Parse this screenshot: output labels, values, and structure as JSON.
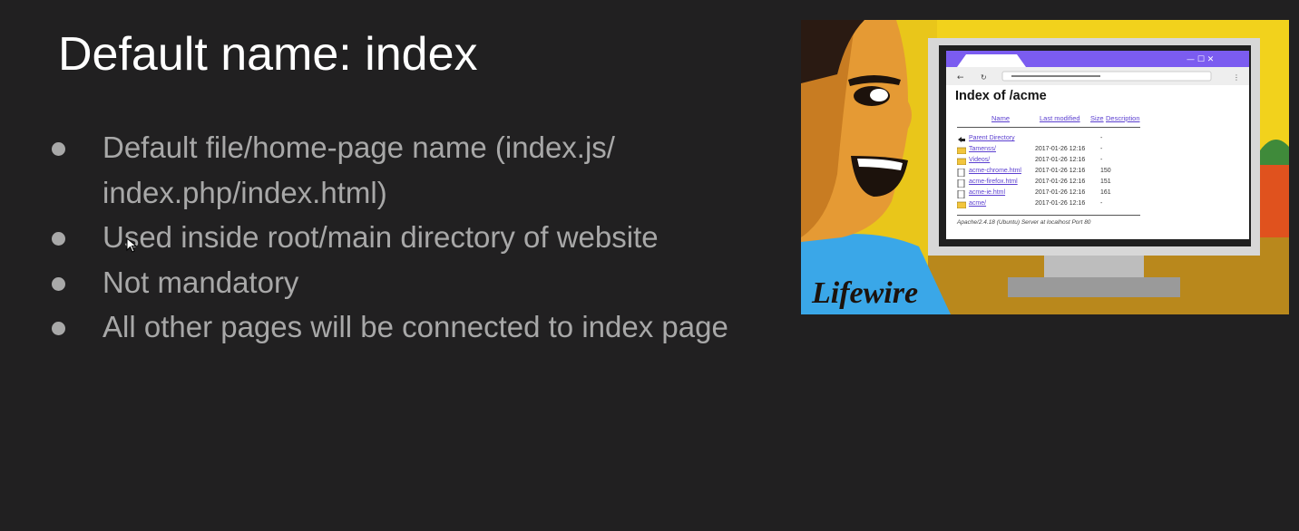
{
  "slide": {
    "title": "Default name: index",
    "bullets": [
      "Default file/home-page name (index.js/ index.php/index.html)",
      "Used inside root/main directory of website",
      "Not mandatory",
      "All other pages will be connected to index page"
    ]
  },
  "illustration": {
    "brand": "Lifewire",
    "page_heading": "Index of /acme",
    "columns": [
      "Name",
      "Last modified",
      "Size",
      "Description"
    ],
    "rows": [
      {
        "icon": "back-arrow-icon",
        "name": "Parent Directory",
        "modified": "",
        "size": "-"
      },
      {
        "icon": "folder-icon",
        "name": "Tamenss/",
        "modified": "2017-01-26 12:16",
        "size": "-"
      },
      {
        "icon": "folder-icon",
        "name": "Videos/",
        "modified": "2017-01-26 12:16",
        "size": "-"
      },
      {
        "icon": "file-icon",
        "name": "acme-chrome.html",
        "modified": "2017-01-26 12:16",
        "size": "150"
      },
      {
        "icon": "file-icon",
        "name": "acme-firefox.html",
        "modified": "2017-01-26 12:16",
        "size": "151"
      },
      {
        "icon": "file-icon",
        "name": "acme-ie.html",
        "modified": "2017-01-26 12:16",
        "size": "161"
      },
      {
        "icon": "folder-icon",
        "name": "acme/",
        "modified": "2017-01-26 12:16",
        "size": "-"
      }
    ],
    "server_footer": "Apache/2.4.18 (Ubuntu) Server at localhost Port 80"
  },
  "colors": {
    "background": "#212021",
    "title_text": "#ffffff",
    "bullet_text": "#a8a8a8",
    "illustration_yellow": "#f2d21c",
    "browser_purple": "#7b5cf0",
    "link_purple": "#5b3fd0"
  }
}
